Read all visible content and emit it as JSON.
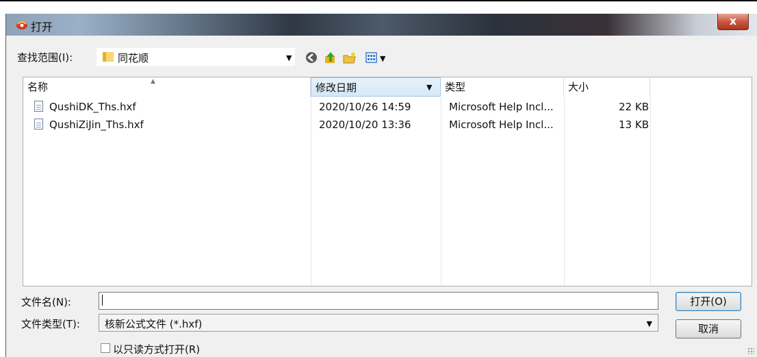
{
  "window": {
    "title": "打开",
    "close_label": "x"
  },
  "toolbar": {
    "lookin_label": "查找范围(I):",
    "lookin_value": "同花顺",
    "icons": [
      "back-icon",
      "up-folder-icon",
      "new-folder-icon",
      "view-menu-icon"
    ]
  },
  "columns": [
    "名称",
    "修改日期",
    "类型",
    "大小"
  ],
  "files": [
    {
      "name": "QushiDK_Ths.hxf",
      "date": "2020/10/26 14:59",
      "type": "Microsoft Help Incl...",
      "size": "22 KB"
    },
    {
      "name": "QushiZiJin_Ths.hxf",
      "date": "2020/10/20 13:36",
      "type": "Microsoft Help Incl...",
      "size": "13 KB"
    }
  ],
  "form": {
    "filename_label": "文件名(N):",
    "filename_value": "",
    "filetype_label": "文件类型(T):",
    "filetype_value": "核新公式文件 (*.hxf)",
    "readonly_label": "以只读方式打开(R)"
  },
  "buttons": {
    "open": "打开(O)",
    "cancel": "取消"
  },
  "colors": {
    "accent": "#3c7fb1",
    "close": "#c85a45"
  }
}
